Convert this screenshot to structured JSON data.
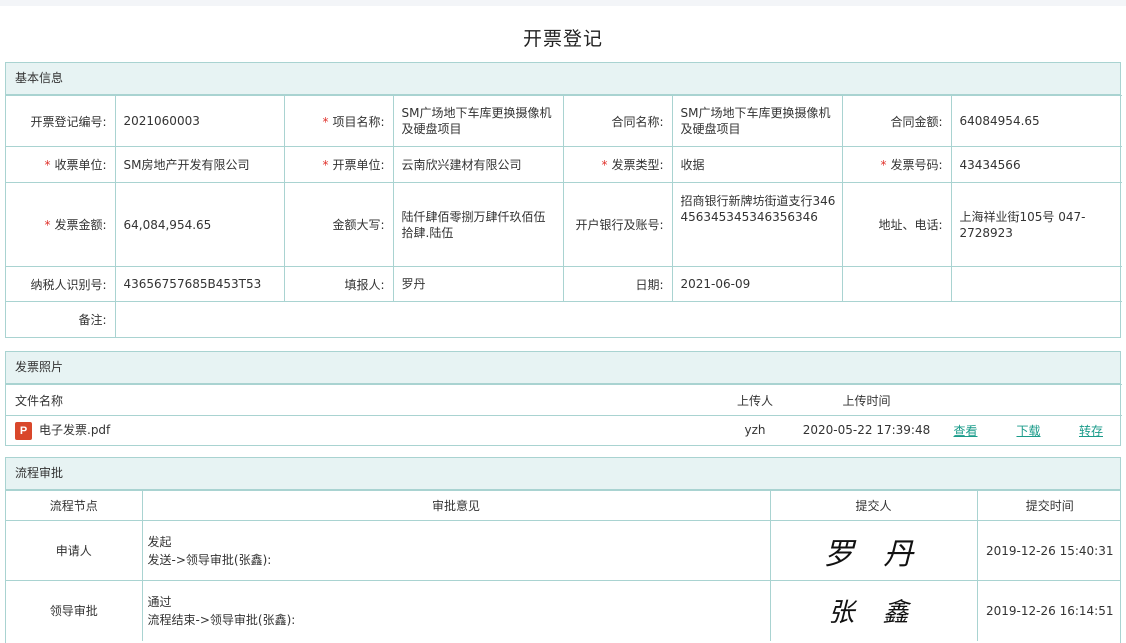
{
  "title": "开票登记",
  "basic": {
    "header": "基本信息",
    "rows": [
      [
        {
          "label": "开票登记编号:",
          "value": "2021060003",
          "required": false
        },
        {
          "label": "项目名称:",
          "value": "SM广场地下车库更换摄像机及硬盘项目",
          "required": true
        },
        {
          "label": "合同名称:",
          "value": "SM广场地下车库更换摄像机及硬盘项目",
          "required": false
        },
        {
          "label": "合同金额:",
          "value": "64084954.65",
          "required": false
        }
      ],
      [
        {
          "label": "收票单位:",
          "value": "SM房地产开发有限公司",
          "required": true
        },
        {
          "label": "开票单位:",
          "value": "云南欣兴建材有限公司",
          "required": true
        },
        {
          "label": "发票类型:",
          "value": "收据",
          "required": true
        },
        {
          "label": "发票号码:",
          "value": "43434566",
          "required": true
        }
      ],
      [
        {
          "label": "发票金额:",
          "value": "64,084,954.65",
          "required": true
        },
        {
          "label": "金额大写:",
          "value": "陆仟肆佰零捌万肆仟玖佰伍拾肆.陆伍",
          "required": false
        },
        {
          "label": "开户银行及账号:",
          "value": "招商银行新牌坊街道支行346456345345346356346",
          "required": false
        },
        {
          "label": "地址、电话:",
          "value": "上海祥业街105号 047-2728923",
          "required": false
        }
      ],
      [
        {
          "label": "纳税人识别号:",
          "value": "43656757685B453T53",
          "required": false
        },
        {
          "label": "填报人:",
          "value": "罗丹",
          "required": false
        },
        {
          "label": "日期:",
          "value": "2021-06-09",
          "required": false
        },
        {
          "label": "",
          "value": "",
          "required": false
        }
      ]
    ],
    "remark_label": "备注:",
    "remark_value": ""
  },
  "photo": {
    "header": "发票照片",
    "columns": [
      "文件名称",
      "上传人",
      "上传时间"
    ],
    "file": {
      "icon": "pdf-file-icon",
      "icon_glyph": "P",
      "name": "电子发票.pdf",
      "uploader": "yzh",
      "time": "2020-05-22 17:39:48",
      "view": "查看",
      "download": "下载",
      "transfer": "转存"
    }
  },
  "flow": {
    "header": "流程审批",
    "columns": [
      "流程节点",
      "审批意见",
      "提交人",
      "提交时间"
    ],
    "rows": [
      {
        "node": "申请人",
        "opinion": "发起",
        "detail": "发送->领导审批(张鑫):",
        "signature": "罗 丹",
        "time": "2019-12-26 15:40:31"
      },
      {
        "node": "领导审批",
        "opinion": "通过",
        "detail": "流程结束->领导审批(张鑫):",
        "signature": "张 鑫",
        "time": "2019-12-26 16:14:51"
      }
    ]
  },
  "colors": {
    "accent": "#1a9b8a",
    "border": "#a9d3d1",
    "header_bg": "#e7f3f3",
    "required": "#e0312b"
  }
}
